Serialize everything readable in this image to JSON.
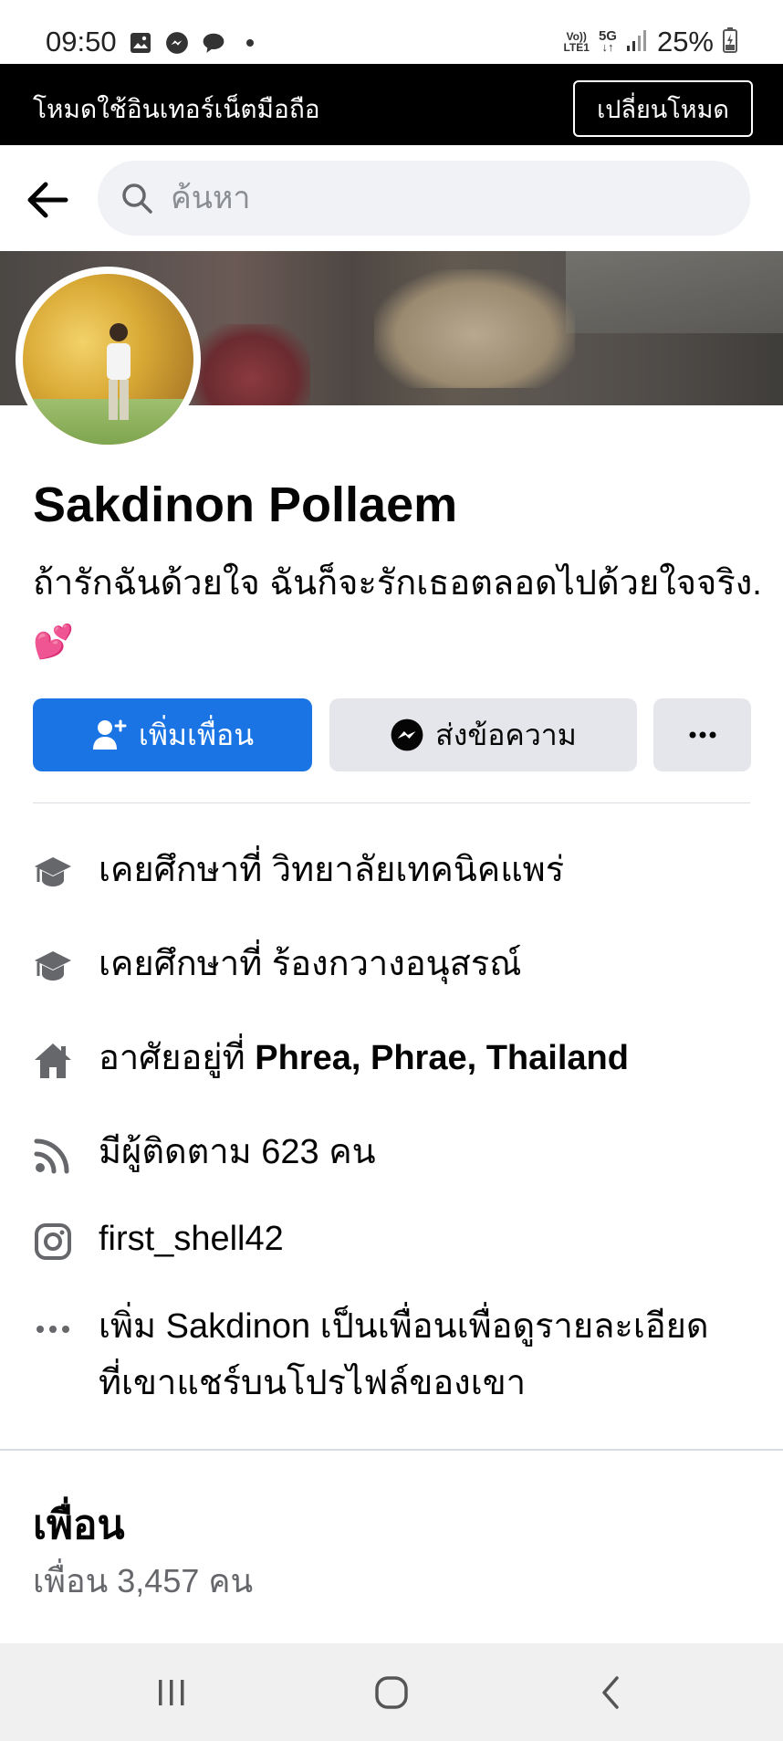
{
  "status_bar": {
    "time": "09:50",
    "network_top": "Vo))",
    "network_bottom": "LTE1",
    "five_g": "5G",
    "battery": "25%",
    "left_icons": [
      "gallery-icon",
      "messenger-icon",
      "chat-bubble-icon",
      "dot-icon"
    ]
  },
  "banner": {
    "text": "โหมดใช้อินเทอร์เน็ตมือถือ",
    "button_label": "เปลี่ยนโหมด"
  },
  "search": {
    "placeholder": "ค้นหา"
  },
  "profile": {
    "name": "Sakdinon Pollaem",
    "bio": "ถ้ารักฉันด้วยใจ ฉันก็จะรักเธอตลอดไปด้วยใจจริง.",
    "bio_emoji": "💕"
  },
  "actions": {
    "add_friend": "เพิ่มเพื่อน",
    "message": "ส่งข้อความ",
    "more": "···"
  },
  "details": [
    {
      "icon": "graduation-cap-icon",
      "prefix": "เคยศึกษาที่ ",
      "value": "วิทยาลัยเทคนิคแพร่",
      "bold": false
    },
    {
      "icon": "graduation-cap-icon",
      "prefix": "เคยศึกษาที่ ",
      "value": "ร้องกวางอนุสรณ์",
      "bold": false
    },
    {
      "icon": "home-icon",
      "prefix": "อาศัยอยู่ที่ ",
      "value": "Phrea, Phrae, Thailand",
      "bold": true
    },
    {
      "icon": "rss-icon",
      "prefix": "",
      "value": "มีผู้ติดตาม 623 คน",
      "bold": false
    },
    {
      "icon": "instagram-icon",
      "prefix": "",
      "value": "first_shell42",
      "bold": false
    },
    {
      "icon": "more-icon",
      "prefix": "",
      "value": "เพิ่ม Sakdinon เป็นเพื่อนเพื่อดูรายละเอียดที่เขาแชร์บนโปรไฟล์ของเขา",
      "bold": false
    }
  ],
  "friends": {
    "title": "เพื่อน",
    "count": "เพื่อน 3,457 คน"
  },
  "colors": {
    "primary_button": "#1b74e4",
    "secondary_button": "#e4e6eb",
    "banner_bg": "#000000",
    "muted_text": "#65676b"
  }
}
